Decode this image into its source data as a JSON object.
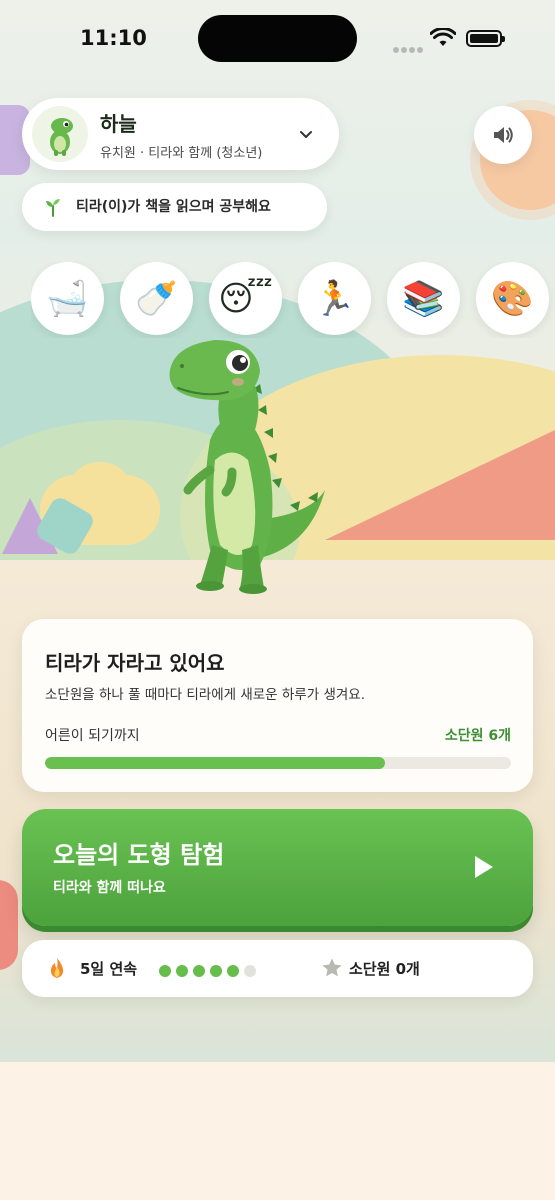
{
  "status_bar": {
    "time": "11:10"
  },
  "profile": {
    "name": "하늘",
    "subtitle": "유치원 · 티라와 함께 (청소년)"
  },
  "activity": {
    "text": "티라(이)가 책을 읽으며 공부해요"
  },
  "actions": [
    {
      "icon": "🛁",
      "name": "bath"
    },
    {
      "icon": "🍼",
      "name": "feed"
    },
    {
      "icon": "😴",
      "name": "sleep"
    },
    {
      "icon": "🏃",
      "name": "exercise"
    },
    {
      "icon": "📚",
      "name": "study"
    },
    {
      "icon": "🎨",
      "name": "art"
    }
  ],
  "growth": {
    "title": "티라가 자라고 있어요",
    "description": "소단원을 하나 풀 때마다 티라에게 새로운 하루가 생겨요.",
    "progress_label": "어른이 되기까지",
    "progress_count": "소단원 6개",
    "progress": 0.73
  },
  "adventure": {
    "title": "오늘의 도형 탐험",
    "subtitle": "티라와 함께 떠나요"
  },
  "streak": {
    "text": "5일 연속",
    "filled_dots": 5,
    "total_dots": 6,
    "badge_text": "소단원 0개"
  },
  "colors": {
    "accent_green": "#5cb547",
    "progress_green": "#69c04f",
    "count_green": "#3d8f33"
  }
}
